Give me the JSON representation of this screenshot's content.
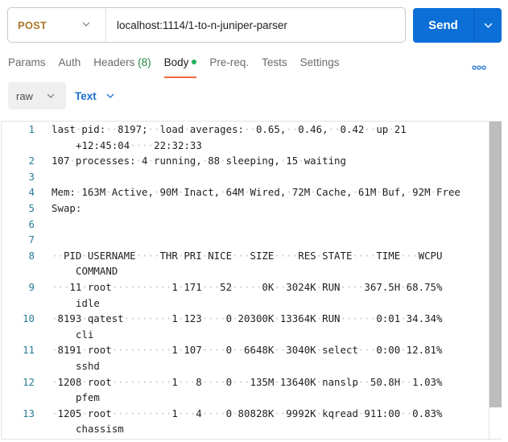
{
  "request": {
    "method": "POST",
    "url": "localhost:1114/1-to-n-juniper-parser",
    "send_label": "Send"
  },
  "tabs": [
    {
      "label": "Params"
    },
    {
      "label": "Auth"
    },
    {
      "label": "Headers",
      "count": "(8)"
    },
    {
      "label": "Body",
      "active": true,
      "indicator": true
    },
    {
      "label": "Pre-req."
    },
    {
      "label": "Tests"
    },
    {
      "label": "Settings"
    }
  ],
  "body_options": {
    "mode": "raw",
    "format": "Text"
  },
  "colors": {
    "method": "#a8772a",
    "send": "#0c6fd8",
    "active_tab_underline": "#f26b3a",
    "body_indicator": "#1fb35b",
    "headers_count": "#1e8a3c",
    "format_link": "#1a6fcf",
    "line_number": "#2a7d94"
  },
  "editor": {
    "scroll_fraction_visible": 0.9,
    "lines": [
      {
        "n": "1",
        "segments": [
          "last pid:  8197;  load averages:  0.65,  0.46,  0.42  up 21",
          "+12:45:04    22:32:33"
        ]
      },
      {
        "n": "2",
        "segments": [
          "107 processes: 4 running, 88 sleeping, 15 waiting"
        ]
      },
      {
        "n": "3",
        "segments": [
          ""
        ]
      },
      {
        "n": "4",
        "segments": [
          "Mem: 163M Active, 90M Inact, 64M Wired, 72M Cache, 61M Buf, 92M Free"
        ]
      },
      {
        "n": "5",
        "segments": [
          "Swap:"
        ]
      },
      {
        "n": "6",
        "segments": [
          ""
        ]
      },
      {
        "n": "7",
        "segments": [
          ""
        ]
      },
      {
        "n": "8",
        "segments": [
          "  PID USERNAME    THR PRI NICE   SIZE    RES STATE    TIME   WCPU",
          "COMMAND"
        ]
      },
      {
        "n": "9",
        "segments": [
          "   11 root          1 171   52     0K  3024K RUN    367.5H 68.75%",
          "idle"
        ]
      },
      {
        "n": "10",
        "segments": [
          " 8193 qatest        1 123    0 20300K 13364K RUN      0:01 34.34%",
          "cli"
        ]
      },
      {
        "n": "11",
        "segments": [
          " 8191 root          1 107    0  6648K  3040K select   0:00 12.81%",
          "sshd"
        ]
      },
      {
        "n": "12",
        "segments": [
          " 1208 root          1   8    0   135M 13640K nanslp  50.8H  1.03%",
          "pfem"
        ]
      },
      {
        "n": "13",
        "segments": [
          " 1205 root          1   4    0 80828K  9992K kqread 911:00  0.83%",
          "chassism"
        ]
      }
    ]
  }
}
